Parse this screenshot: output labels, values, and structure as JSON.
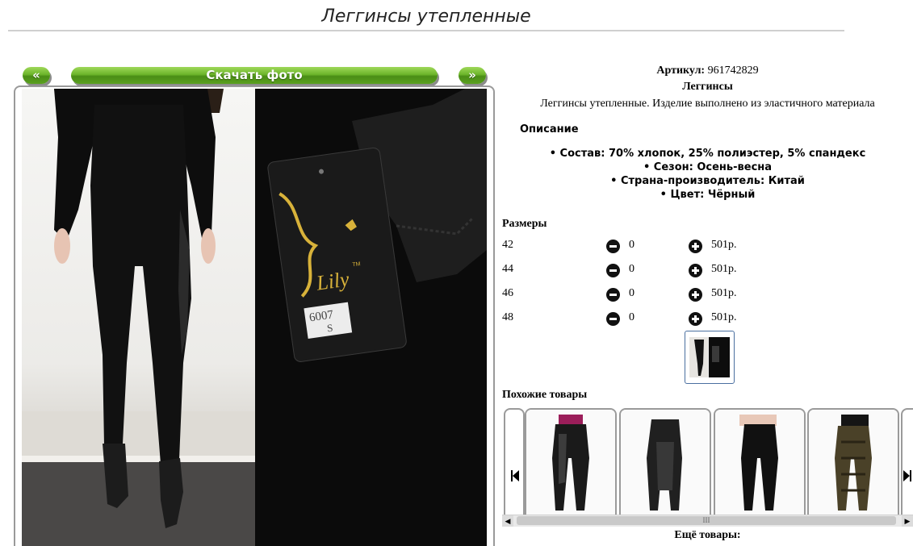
{
  "page": {
    "title": "Леггинсы утепленные"
  },
  "gallery": {
    "prev_label": "«",
    "download_label": "Скачать фото",
    "next_label": "»",
    "tag_brand": "Lily",
    "tag_tm": "TM",
    "tag_code": "6007",
    "tag_size": "S"
  },
  "product": {
    "article_label": "Артикул:",
    "article_value": "961742829",
    "name": "Леггинсы",
    "summary": "Леггинсы утепленные. Изделие выполнено из эластичного материала",
    "description_label": "Описание",
    "specs": [
      "• Состав: 70% хлопок, 25% полиэстер, 5% спандекс",
      "• Сезон: Осень-весна",
      "• Страна-производитель: Китай",
      "• Цвет: Чёрный"
    ]
  },
  "sizes": {
    "label": "Размеры",
    "rows": [
      {
        "size": "42",
        "qty": "0",
        "price": "501р."
      },
      {
        "size": "44",
        "qty": "0",
        "price": "501р."
      },
      {
        "size": "46",
        "qty": "0",
        "price": "501р."
      },
      {
        "size": "48",
        "qty": "0",
        "price": "501р."
      }
    ]
  },
  "similar": {
    "label": "Похожие товары",
    "scroll_grip": "III"
  },
  "more": {
    "label": "Ещё товары:"
  },
  "icons": {
    "minus": "minus-circle-icon",
    "plus": "plus-circle-icon",
    "carousel_prev": "skip-back-icon",
    "carousel_next": "skip-forward-icon"
  },
  "colors": {
    "button_green": "#6cb52a",
    "frame_gray": "#9a9a9a",
    "thumb_border": "#4a6fa0"
  }
}
